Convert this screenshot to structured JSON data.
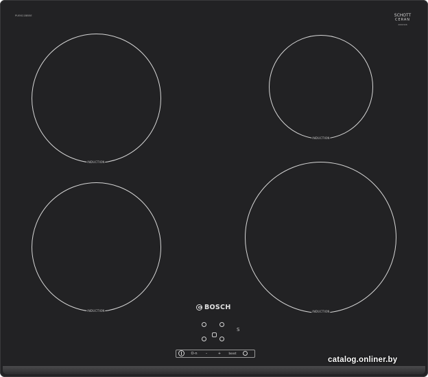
{
  "product": {
    "brand": "BOSCH",
    "model_code": "PUE611BB5E",
    "surface_maker": {
      "line1": "SCHOTT",
      "line2": "CERAN",
      "line3": "2000326"
    },
    "surface_color": "#222224",
    "marking_color": "#d8d8d8"
  },
  "zones": [
    {
      "id": "front-left",
      "label": "INDUCTION"
    },
    {
      "id": "rear-right",
      "label": "INDUCTION"
    },
    {
      "id": "back-left",
      "label": "INDUCTION"
    },
    {
      "id": "front-right",
      "label": "INDUCTION"
    }
  ],
  "controls": {
    "power_icon": "power-icon",
    "key_lock": "O-n",
    "minus": "–",
    "plus": "+",
    "boost": "boost",
    "timer_icon": "timer-icon",
    "side_symbol": "S",
    "small_mark": "dry"
  },
  "watermark": "catalog.onliner.by"
}
